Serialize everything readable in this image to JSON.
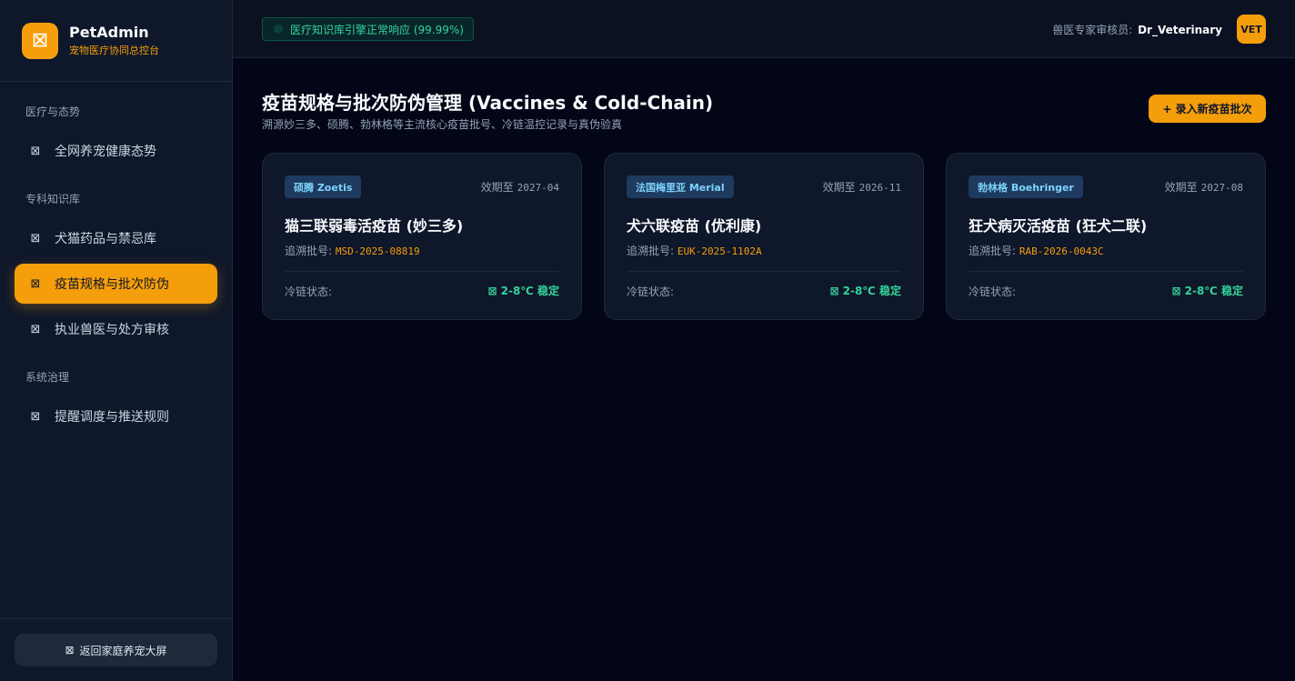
{
  "brand": {
    "title": "PetAdmin",
    "subtitle": "宠物医疗协同总控台",
    "logo_icon": "⊠"
  },
  "sidebar": {
    "sections": [
      {
        "label": "医疗与态势"
      },
      {
        "label": "专科知识库"
      },
      {
        "label": "系统治理"
      }
    ],
    "items": [
      {
        "label": "全网养宠健康态势",
        "icon": "⊠"
      },
      {
        "label": "犬猫药品与禁忌库",
        "icon": "⊠"
      },
      {
        "label": "疫苗规格与批次防伪",
        "icon": "⊠",
        "active": true
      },
      {
        "label": "执业兽医与处方审核",
        "icon": "⊠"
      },
      {
        "label": "提醒调度与推送规则",
        "icon": "⊠"
      }
    ],
    "footer_button": {
      "label": "返回家庭养宠大屏",
      "icon": "⊠"
    }
  },
  "topbar": {
    "status": "医疗知识库引擎正常响应 (99.99%)",
    "reviewer_label": "兽医专家审核员:",
    "reviewer_name": "Dr_Veterinary",
    "avatar": "VET"
  },
  "main": {
    "title": "疫苗规格与批次防伪管理 (Vaccines & Cold-Chain)",
    "subtitle": "溯源妙三多、硕腾、勃林格等主流核心疫苗批号、冷链温控记录与真伪验真",
    "add_button": "+ 录入新疫苗批次",
    "cards": [
      {
        "brand": "硕腾 Zoetis",
        "expiry_label": "效期至",
        "expiry": "2027-04",
        "name": "猫三联弱毒活疫苗 (妙三多)",
        "batch_label": "追溯批号:",
        "batch": "MSD-2025-08819",
        "cold_label": "冷链状态:",
        "cold_icon": "⊠",
        "cold_value": "2-8℃ 稳定"
      },
      {
        "brand": "法国梅里亚 Merial",
        "expiry_label": "效期至",
        "expiry": "2026-11",
        "name": "犬六联疫苗 (优利康)",
        "batch_label": "追溯批号:",
        "batch": "EUK-2025-1102A",
        "cold_label": "冷链状态:",
        "cold_icon": "⊠",
        "cold_value": "2-8℃ 稳定"
      },
      {
        "brand": "勃林格 Boehringer",
        "expiry_label": "效期至",
        "expiry": "2027-08",
        "name": "狂犬病灭活疫苗 (狂犬二联)",
        "batch_label": "追溯批号:",
        "batch": "RAB-2026-0043C",
        "cold_label": "冷链状态:",
        "cold_icon": "⊠",
        "cold_value": "2-8℃ 稳定"
      }
    ]
  },
  "colors": {
    "accent": "#f59e0b",
    "success": "#34d399",
    "bg": "#020617",
    "panel": "#0f172a"
  }
}
